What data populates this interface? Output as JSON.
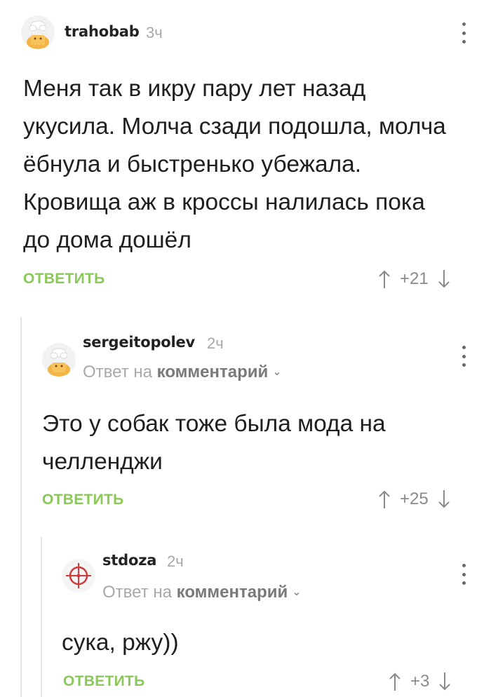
{
  "comments": [
    {
      "username": "trahobab",
      "time": "3ч",
      "body": "Меня так в икру пару лет назад укусила. Молча сзади подошла, молча ёбнула и быстренько убежала. Кровища аж в кроссы налилась пока до дома дошёл",
      "reply_label": "ОТВЕТИТЬ",
      "score": "+21"
    },
    {
      "username": "sergeitopolev",
      "time": "2ч",
      "reply_prefix": "Ответ на",
      "reply_target": "комментарий",
      "body": "Это у собак тоже была мода на челленджи",
      "reply_label": "ОТВЕТИТЬ",
      "score": "+25"
    },
    {
      "username": "stdoza",
      "time": "2ч",
      "reply_prefix": "Ответ на",
      "reply_target": "комментарий",
      "body": "сука, ржу))",
      "reply_label": "ОТВЕТИТЬ",
      "score": "+3"
    }
  ],
  "icons": {
    "more": "more-vertical-icon",
    "upvote": "arrow-up-icon",
    "downvote": "arrow-down-icon",
    "dropdown": "chevron-down-icon"
  },
  "colors": {
    "accent_green": "#8ac858",
    "muted": "#a8a8a8",
    "thread_line": "#e3e3e3"
  }
}
